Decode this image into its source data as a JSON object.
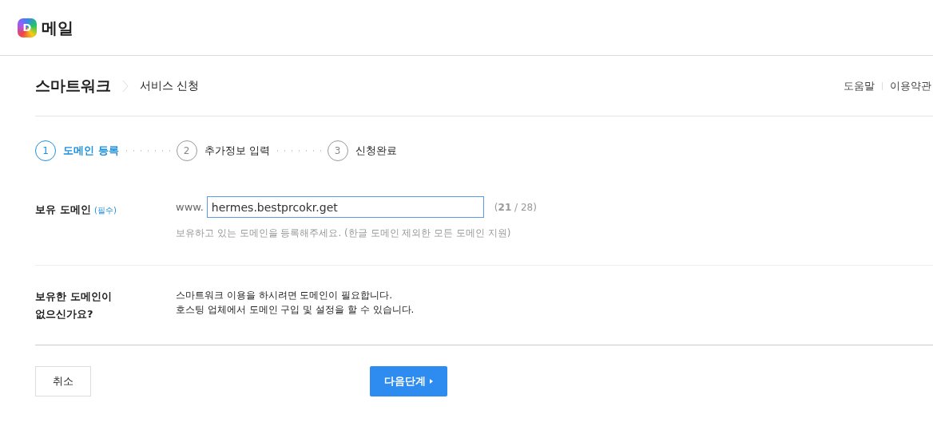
{
  "header": {
    "logo_letter": "D",
    "title": "메일"
  },
  "breadcrumb": {
    "section": "스마트워크",
    "page": "서비스 신청"
  },
  "top_links": [
    "도움말",
    "이용약관"
  ],
  "steps": [
    {
      "number": "1",
      "label": "도메인 등록",
      "selected": true
    },
    {
      "number": "2",
      "label": "추가정보 입력",
      "selected": false
    },
    {
      "number": "3",
      "label": "신청완료",
      "selected": false
    }
  ],
  "domain": {
    "label": "보유 도메인",
    "required": "(필수)",
    "prefix": "www.",
    "value": "hermes.bestprcokr.get",
    "counter": "(**21** / 28)",
    "hint": "보유하고 있는 도메인을 등록해주세요. (한글 도메인 제외한 모든 도메인 지원)"
  },
  "no_domain": {
    "label_lines": [
      "보유한 도메인이",
      "없으신가요?"
    ],
    "lines": [
      "스마트워크 이용을 하시려면 도메인이 필요합니다.",
      "호스팅 업체에서 도메인 구입 및 설정을 할 수 있습니다."
    ]
  },
  "buttons": {
    "cancel": "취소",
    "next": "다음단계"
  }
}
